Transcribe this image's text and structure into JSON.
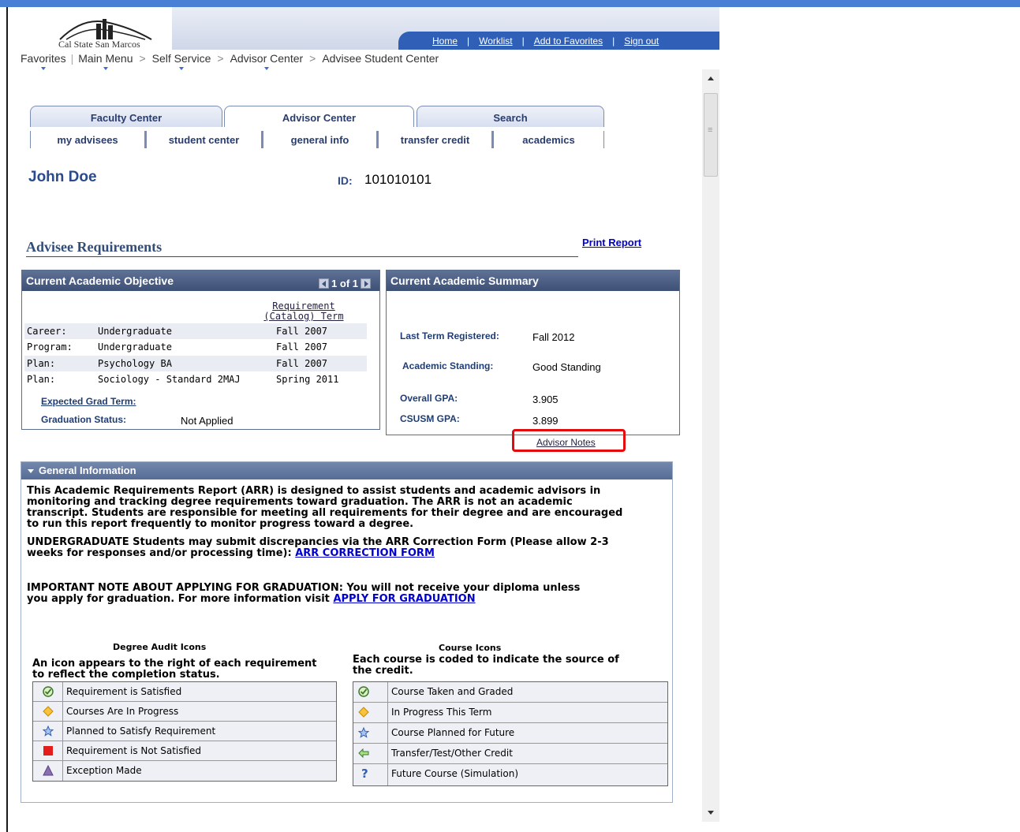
{
  "header": {
    "logo_text": "Cal State San Marcos",
    "nav_links": [
      "Home",
      "Worklist",
      "Add to Favorites",
      "Sign out"
    ]
  },
  "breadcrumbs": {
    "favorites": "Favorites",
    "main_menu": "Main Menu",
    "self_service": "Self Service",
    "advisor_center": "Advisor Center",
    "current": "Advisee Student Center",
    "separator": ">"
  },
  "tabs": [
    "Faculty Center",
    "Advisor Center",
    "Search"
  ],
  "subtabs": [
    "my advisees",
    "student center",
    "general info",
    "transfer credit",
    "academics"
  ],
  "student": {
    "name": "John Doe",
    "id_label": "ID:",
    "id_value": "101010101"
  },
  "section": {
    "title": "Advisee Requirements",
    "print_label": "Print Report"
  },
  "objective": {
    "title": "Current Academic Objective",
    "pager": "1 of 1",
    "req_term_header": "Requirement (Catalog) Term",
    "rows": [
      {
        "label": "Career:",
        "value": "Undergraduate",
        "term": "Fall 2007"
      },
      {
        "label": "Program:",
        "value": "Undergraduate",
        "term": "Fall 2007"
      },
      {
        "label": "Plan:",
        "value": "Psychology BA",
        "term": "Fall 2007"
      },
      {
        "label": "Plan:",
        "value": "Sociology - Standard 2MAJ",
        "term": "Spring 2011"
      }
    ],
    "expected_grad_label": "Expected Grad Term:",
    "grad_status_label": "Graduation Status:",
    "grad_status_value": "Not Applied"
  },
  "summary": {
    "title": "Current Academic Summary",
    "last_term_label": "Last Term Registered:",
    "last_term_value": "Fall 2012",
    "standing_label": "Academic Standing:",
    "standing_value": "Good Standing",
    "overall_gpa_label": "Overall GPA:",
    "overall_gpa_value": "3.905",
    "csusm_gpa_label": "CSUSM GPA:",
    "csusm_gpa_value": "3.899",
    "advisor_notes": "Advisor Notes"
  },
  "general_info": {
    "title": "General Information",
    "p1": "This Academic Requirements Report (ARR) is designed to assist students and academic advisors in\nmonitoring and tracking degree requirements toward graduation. The ARR is not an academic\ntranscript. Students are responsible for meeting all requirements for their degree and are encouraged\nto run this report frequently to monitor progress toward a degree.",
    "p2_text": "UNDERGRADUATE Students may submit discrepancies via the ARR Correction Form (Please allow 2-3\nweeks for responses and/or processing time):",
    "p2_link": "ARR CORRECTION FORM",
    "p3_text": "IMPORTANT NOTE ABOUT APPLYING FOR GRADUATION: You will not receive your diploma unless\nyou apply for graduation. For more information visit",
    "p3_link": "APPLY FOR GRADUATION"
  },
  "degree_icons": {
    "title": "Degree Audit Icons",
    "desc": "An icon appears to the right of each requirement\nto reflect the completion status.",
    "items": [
      {
        "icon": "check-icon",
        "label": "Requirement is Satisfied"
      },
      {
        "icon": "diamond-icon",
        "label": "Courses Are In Progress"
      },
      {
        "icon": "star-icon",
        "label": "Planned to Satisfy Requirement"
      },
      {
        "icon": "red-square-icon",
        "label": "Requirement is Not Satisfied"
      },
      {
        "icon": "triangle-icon",
        "label": "Exception Made"
      }
    ]
  },
  "course_icons": {
    "title": "Course Icons",
    "desc": "Each course is coded to indicate the source of\nthe credit.",
    "items": [
      {
        "icon": "check-icon",
        "label": "Course Taken and Graded"
      },
      {
        "icon": "diamond-icon",
        "label": "In Progress This Term"
      },
      {
        "icon": "star-icon",
        "label": "Course Planned for Future"
      },
      {
        "icon": "arrow-left-icon",
        "label": "Transfer/Test/Other Credit"
      },
      {
        "icon": "question-icon",
        "label": "Future Course (Simulation)"
      }
    ]
  }
}
